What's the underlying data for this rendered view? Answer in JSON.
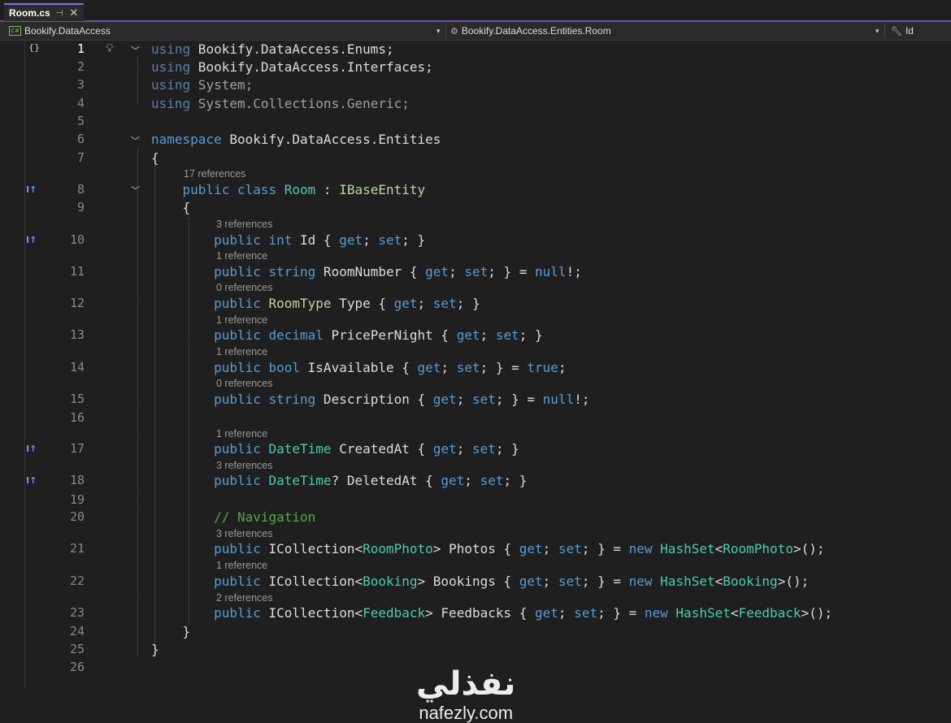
{
  "tab": {
    "title": "Room.cs",
    "pin": "⊣",
    "close": "✕"
  },
  "navbar": {
    "project": "Bookify.DataAccess",
    "type": "Bookify.DataAccess.Entities.Room",
    "member": "Id",
    "dropdown": "▾"
  },
  "codelens": {
    "l8": "17 references",
    "l10": "3 references",
    "l11": "1 reference",
    "l12": "0 references",
    "l13": "1 reference",
    "l14": "1 reference",
    "l15": "0 references",
    "l17": "1 reference",
    "l18": "3 references",
    "l21": "3 references",
    "l22": "1 reference",
    "l23": "2 references"
  },
  "lines": [
    {
      "n": "1",
      "segs": [
        [
          "dim",
          "using"
        ],
        [
          "p",
          " Bookify.DataAccess.Enums;"
        ]
      ]
    },
    {
      "n": "2",
      "segs": [
        [
          "dim",
          "using"
        ],
        [
          "p",
          " Bookify.DataAccess.Interfaces;"
        ]
      ]
    },
    {
      "n": "3",
      "segs": [
        [
          "dim",
          "using"
        ],
        [
          "dimtxt",
          " System;"
        ]
      ]
    },
    {
      "n": "4",
      "segs": [
        [
          "dim",
          "using"
        ],
        [
          "dimtxt",
          " System.Collections.Generic;"
        ]
      ]
    },
    {
      "n": "5",
      "segs": []
    },
    {
      "n": "6",
      "segs": [
        [
          "kw",
          "namespace"
        ],
        [
          "p",
          " Bookify.DataAccess.Entities"
        ]
      ]
    },
    {
      "n": "7",
      "segs": [
        [
          "p",
          "{"
        ]
      ]
    },
    {
      "n": "8",
      "segs": [
        [
          "kw",
          "    public class "
        ],
        [
          "ty",
          "Room"
        ],
        [
          "p",
          " : "
        ],
        [
          "iface",
          "IBaseEntity"
        ]
      ]
    },
    {
      "n": "9",
      "segs": [
        [
          "p",
          "    {"
        ]
      ]
    },
    {
      "n": "10",
      "segs": [
        [
          "kw",
          "        public int"
        ],
        [
          "p",
          " Id { "
        ],
        [
          "kw",
          "get"
        ],
        [
          "p",
          "; "
        ],
        [
          "kw",
          "set"
        ],
        [
          "p",
          "; }"
        ]
      ]
    },
    {
      "n": "11",
      "segs": [
        [
          "kw",
          "        public string"
        ],
        [
          "p",
          " RoomNumber { "
        ],
        [
          "kw",
          "get"
        ],
        [
          "p",
          "; "
        ],
        [
          "kw",
          "set"
        ],
        [
          "p",
          "; } = "
        ],
        [
          "kw",
          "null"
        ],
        [
          "p",
          "!;"
        ]
      ]
    },
    {
      "n": "12",
      "segs": [
        [
          "kw",
          "        public "
        ],
        [
          "iface",
          "RoomType"
        ],
        [
          "p",
          " Type { "
        ],
        [
          "kw",
          "get"
        ],
        [
          "p",
          "; "
        ],
        [
          "kw",
          "set"
        ],
        [
          "p",
          "; }"
        ]
      ]
    },
    {
      "n": "13",
      "segs": [
        [
          "kw",
          "        public decimal"
        ],
        [
          "p",
          " PricePerNight { "
        ],
        [
          "kw",
          "get"
        ],
        [
          "p",
          "; "
        ],
        [
          "kw",
          "set"
        ],
        [
          "p",
          "; }"
        ]
      ]
    },
    {
      "n": "14",
      "segs": [
        [
          "kw",
          "        public bool"
        ],
        [
          "p",
          " IsAvailable { "
        ],
        [
          "kw",
          "get"
        ],
        [
          "p",
          "; "
        ],
        [
          "kw",
          "set"
        ],
        [
          "p",
          "; } = "
        ],
        [
          "kw",
          "true"
        ],
        [
          "p",
          ";"
        ]
      ]
    },
    {
      "n": "15",
      "segs": [
        [
          "kw",
          "        public string"
        ],
        [
          "p",
          " Description { "
        ],
        [
          "kw",
          "get"
        ],
        [
          "p",
          "; "
        ],
        [
          "kw",
          "set"
        ],
        [
          "p",
          "; } = "
        ],
        [
          "kw",
          "null"
        ],
        [
          "p",
          "!;"
        ]
      ]
    },
    {
      "n": "16",
      "segs": []
    },
    {
      "n": "17",
      "segs": [
        [
          "kw",
          "        public "
        ],
        [
          "ty",
          "DateTime"
        ],
        [
          "p",
          " CreatedAt { "
        ],
        [
          "kw",
          "get"
        ],
        [
          "p",
          "; "
        ],
        [
          "kw",
          "set"
        ],
        [
          "p",
          "; }"
        ]
      ]
    },
    {
      "n": "18",
      "segs": [
        [
          "kw",
          "        public "
        ],
        [
          "ty",
          "DateTime"
        ],
        [
          "p",
          "? DeletedAt { "
        ],
        [
          "kw",
          "get"
        ],
        [
          "p",
          "; "
        ],
        [
          "kw",
          "set"
        ],
        [
          "p",
          "; }"
        ]
      ]
    },
    {
      "n": "19",
      "segs": []
    },
    {
      "n": "20",
      "segs": [
        [
          "cm",
          "        // Navigation"
        ]
      ]
    },
    {
      "n": "21",
      "segs": [
        [
          "kw",
          "        public "
        ],
        [
          "p",
          "ICollection<"
        ],
        [
          "ty",
          "RoomPhoto"
        ],
        [
          "p",
          "> Photos { "
        ],
        [
          "kw",
          "get"
        ],
        [
          "p",
          "; "
        ],
        [
          "kw",
          "set"
        ],
        [
          "p",
          "; } = "
        ],
        [
          "kw",
          "new "
        ],
        [
          "ty",
          "HashSet"
        ],
        [
          "p",
          "<"
        ],
        [
          "ty",
          "RoomPhoto"
        ],
        [
          "p",
          ">();"
        ]
      ]
    },
    {
      "n": "22",
      "segs": [
        [
          "kw",
          "        public "
        ],
        [
          "p",
          "ICollection<"
        ],
        [
          "ty",
          "Booking"
        ],
        [
          "p",
          "> Bookings { "
        ],
        [
          "kw",
          "get"
        ],
        [
          "p",
          "; "
        ],
        [
          "kw",
          "set"
        ],
        [
          "p",
          "; } = "
        ],
        [
          "kw",
          "new "
        ],
        [
          "ty",
          "HashSet"
        ],
        [
          "p",
          "<"
        ],
        [
          "ty",
          "Booking"
        ],
        [
          "p",
          ">();"
        ]
      ]
    },
    {
      "n": "23",
      "segs": [
        [
          "kw",
          "        public "
        ],
        [
          "p",
          "ICollection<"
        ],
        [
          "ty",
          "Feedback"
        ],
        [
          "p",
          "> Feedbacks { "
        ],
        [
          "kw",
          "get"
        ],
        [
          "p",
          "; "
        ],
        [
          "kw",
          "set"
        ],
        [
          "p",
          "; } = "
        ],
        [
          "kw",
          "new "
        ],
        [
          "ty",
          "HashSet"
        ],
        [
          "p",
          "<"
        ],
        [
          "ty",
          "Feedback"
        ],
        [
          "p",
          ">();"
        ]
      ]
    },
    {
      "n": "24",
      "segs": [
        [
          "p",
          "    }"
        ]
      ]
    },
    {
      "n": "25",
      "segs": [
        [
          "p",
          "}"
        ]
      ]
    },
    {
      "n": "26",
      "segs": []
    }
  ],
  "watermark": {
    "arabic": "نفذلي",
    "latin": "nafezly.com"
  }
}
